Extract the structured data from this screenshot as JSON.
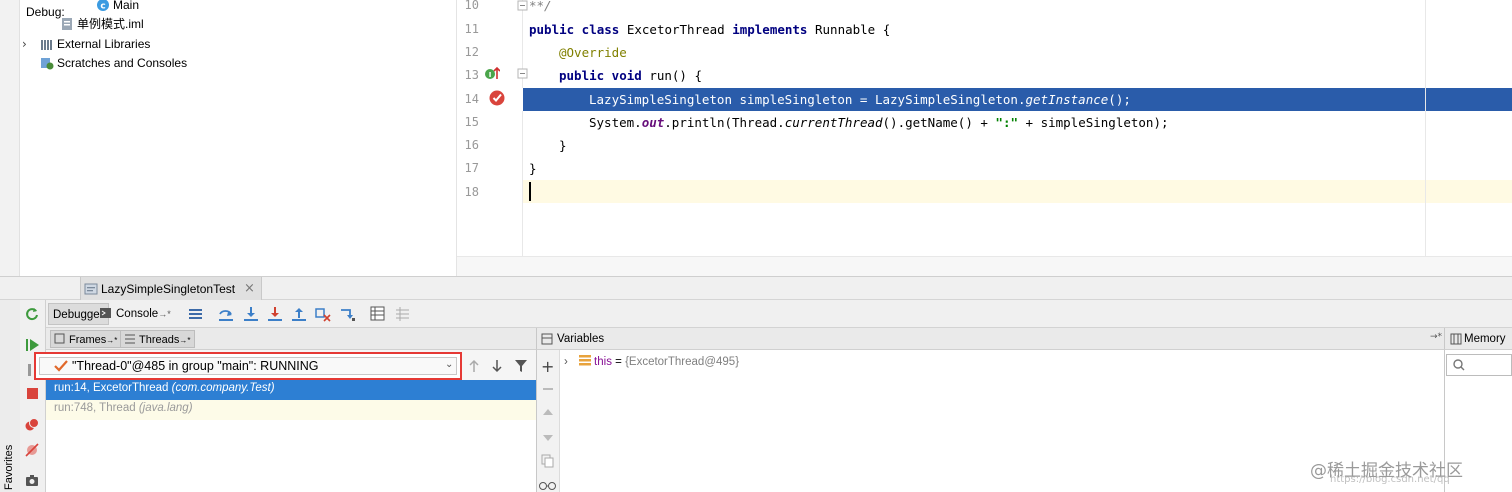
{
  "project_tree": {
    "items": [
      {
        "label": "Main",
        "icon": "class-icon"
      },
      {
        "label": "单例模式.iml",
        "icon": "module-file-icon"
      },
      {
        "label": "External Libraries",
        "icon": "libraries-icon"
      },
      {
        "label": "Scratches and Consoles",
        "icon": "scratches-icon"
      }
    ]
  },
  "editor": {
    "line_numbers": [
      "10",
      "11",
      "12",
      "13",
      "14",
      "15",
      "16",
      "17",
      "18"
    ],
    "lines": {
      "l10": "**/",
      "l11_kw1": "public class",
      "l11_name": " ExcetorThread ",
      "l11_kw2": "implements",
      "l11_rest": " Runnable {",
      "l12": "@Override",
      "l13_kw": "public void",
      "l13_rest": " run() {",
      "l14_a": "LazySimpleSingleton simpleSingleton = LazySimpleSingleton.",
      "l14_b": "getInstance",
      "l14_c": "();",
      "l15_a": "System.",
      "l15_b": "out",
      "l15_c": ".println(Thread.",
      "l15_d": "currentThread",
      "l15_e": "().getName() + ",
      "l15_f": "\":\"",
      "l15_g": " + simpleSingleton);",
      "l16": "}",
      "l17": "}"
    },
    "highlight_color": "#2a5caa"
  },
  "debug": {
    "label": "Debug:",
    "tab_title": "LazySimpleSingletonTest",
    "toolbar": {
      "debugger_tab": "Debugger",
      "console_tab": "Console",
      "console_suffix": "→*"
    },
    "frames": {
      "frames_tab": "Frames",
      "threads_tab": "Threads",
      "tab_suffix": "→*",
      "thread_selected": "\"Thread-0\"@485 in group \"main\": RUNNING",
      "frame_list": [
        {
          "location": "run:14, ExcetorThread",
          "package": "(com.company.Test)"
        },
        {
          "location": "run:748, Thread",
          "package": "(java.lang)"
        }
      ]
    },
    "variables": {
      "title": "Variables",
      "suffix": "→*",
      "row_name": "this",
      "row_eq": " = ",
      "row_value": "{ExcetorThread@495}"
    },
    "memory": {
      "title": "Memory",
      "suffix": "→*"
    }
  },
  "sidebar": {
    "favorites": "Favorites"
  },
  "watermark": {
    "main": "@稀土掘金技术社区",
    "sub": "https://blog.csdn.net/qq"
  }
}
